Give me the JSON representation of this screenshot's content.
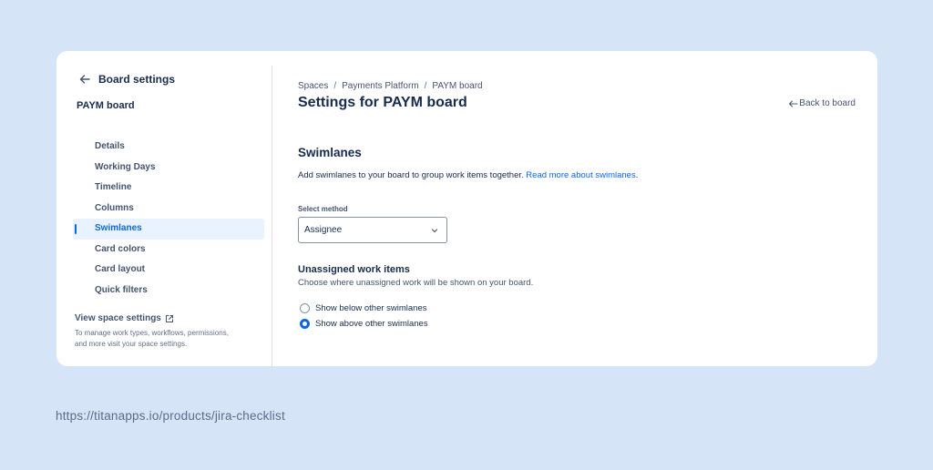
{
  "sidebar": {
    "header": "Board settings",
    "board_name": "PAYM board",
    "items": [
      {
        "label": "Details",
        "active": false
      },
      {
        "label": "Working Days",
        "active": false
      },
      {
        "label": "Timeline",
        "active": false
      },
      {
        "label": "Columns",
        "active": false
      },
      {
        "label": "Swimlanes",
        "active": true
      },
      {
        "label": "Card colors",
        "active": false
      },
      {
        "label": "Card layout",
        "active": false
      },
      {
        "label": "Quick filters",
        "active": false
      }
    ],
    "space_settings_label": "View space settings",
    "space_settings_hint_1": "To manage work types, workflows, permissions,",
    "space_settings_hint_2": "and more visit your space settings."
  },
  "main": {
    "breadcrumb": [
      "Spaces",
      "Payments Platform",
      "PAYM board"
    ],
    "breadcrumb_separator": "/",
    "title": "Settings for PAYM board",
    "back_to_board": "Back to board",
    "section_title": "Swimlanes",
    "section_desc": "Add swimlanes to your board to group work items together.",
    "section_link": "Read more about swimlanes",
    "section_desc_end": ".",
    "select_label": "Select method",
    "select_value": "Assignee",
    "unassigned_title": "Unassigned work items",
    "unassigned_desc": "Choose where unassigned work will be shown on your board.",
    "radio_options": [
      {
        "label": "Show below other swimlanes",
        "checked": false
      },
      {
        "label": "Show above other swimlanes",
        "checked": true
      }
    ]
  },
  "footer_url": "https://titanapps.io/products/jira-checklist",
  "colors": {
    "background": "#d6e4f7",
    "accent": "#0c66e4",
    "active_bg": "#e9f2ff"
  },
  "icons": {
    "back": "arrow-left-icon",
    "external": "external-link-icon",
    "dropdown": "chevron-down-icon"
  }
}
